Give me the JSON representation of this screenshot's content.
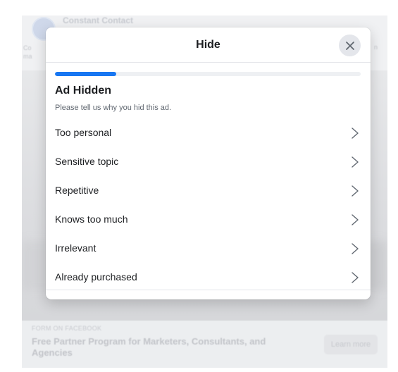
{
  "background_post": {
    "page_name": "Constant Contact",
    "side_text_left": "Co\nma",
    "side_text_right": "n",
    "footer_label": "FORM ON FACEBOOK",
    "footer_title": "Free Partner Program for Marketers, Consultants, and Agencies",
    "cta_label": "Learn more"
  },
  "modal": {
    "title": "Hide",
    "close_icon": "close-icon",
    "progress": 0.2,
    "heading": "Ad Hidden",
    "subtitle": "Please tell us why you hid this ad.",
    "reasons": [
      {
        "label": "Too personal",
        "icon": "chevron-right-icon"
      },
      {
        "label": "Sensitive topic",
        "icon": "chevron-right-icon"
      },
      {
        "label": "Repetitive",
        "icon": "chevron-right-icon"
      },
      {
        "label": "Knows too much",
        "icon": "chevron-right-icon"
      },
      {
        "label": "Irrelevant",
        "icon": "chevron-right-icon"
      },
      {
        "label": "Already purchased",
        "icon": "chevron-right-icon"
      }
    ]
  },
  "colors": {
    "accent": "#1877f2",
    "text_primary": "#1c1e21",
    "text_secondary": "#606770",
    "close_bg": "#e4e6eb"
  }
}
